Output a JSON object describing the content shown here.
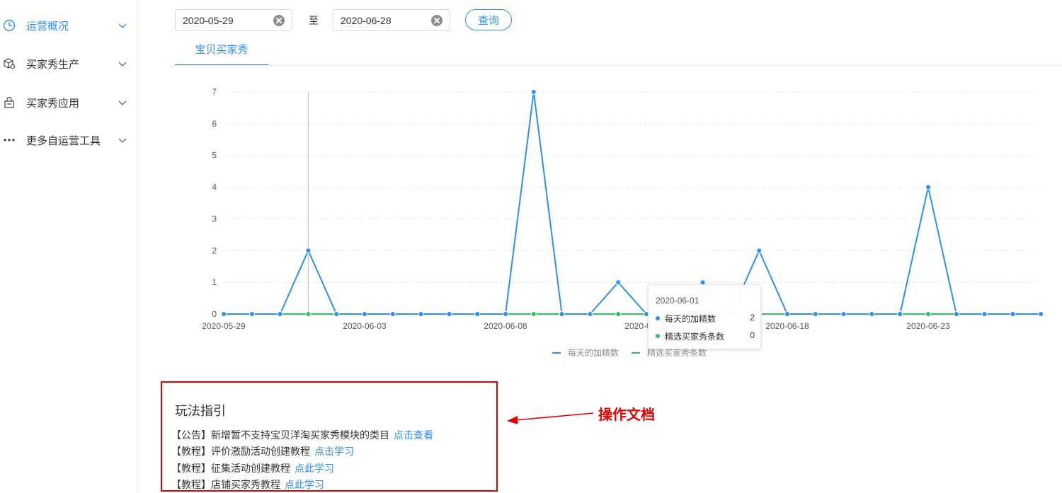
{
  "sidebar": {
    "items": [
      {
        "label": "运营概况",
        "icon": "clock-icon",
        "active": true
      },
      {
        "label": "买家秀生产",
        "icon": "box-icon",
        "active": false
      },
      {
        "label": "买家秀应用",
        "icon": "bag-icon",
        "active": false
      },
      {
        "label": "更多自运营工具",
        "icon": "more-dots-icon",
        "active": false
      }
    ]
  },
  "filter": {
    "start_date": "2020-05-29",
    "to_label": "至",
    "end_date": "2020-06-28",
    "query_label": "查询"
  },
  "tab": {
    "label": "宝贝买家秀"
  },
  "chart_data": {
    "type": "line",
    "title": "",
    "xlabel": "",
    "ylabel": "",
    "ylim": [
      0,
      7
    ],
    "yticks": [
      0,
      1,
      2,
      3,
      4,
      5,
      6,
      7
    ],
    "xtick_labels": [
      "2020-05-29",
      "2020-06-03",
      "2020-06-08",
      "2020-06-13",
      "2020-06-18",
      "2020-06-23"
    ],
    "x": [
      "2020-05-29",
      "2020-05-30",
      "2020-05-31",
      "2020-06-01",
      "2020-06-02",
      "2020-06-03",
      "2020-06-04",
      "2020-06-05",
      "2020-06-06",
      "2020-06-07",
      "2020-06-08",
      "2020-06-09",
      "2020-06-10",
      "2020-06-11",
      "2020-06-12",
      "2020-06-13",
      "2020-06-14",
      "2020-06-15",
      "2020-06-16",
      "2020-06-17",
      "2020-06-18",
      "2020-06-19",
      "2020-06-20",
      "2020-06-21",
      "2020-06-22",
      "2020-06-23",
      "2020-06-24",
      "2020-06-25",
      "2020-06-26",
      "2020-06-27"
    ],
    "series": [
      {
        "name": "每天的加精数",
        "color": "#2a8ff7",
        "values": [
          0,
          0,
          0,
          2,
          0,
          0,
          0,
          0,
          0,
          0,
          0,
          7,
          0,
          0,
          1,
          0,
          0,
          1,
          0,
          2,
          0,
          0,
          0,
          0,
          0,
          4,
          0,
          0,
          0,
          0
        ]
      },
      {
        "name": "精选买家秀条数",
        "color": "#2fc25b",
        "values": [
          0,
          0,
          0,
          0,
          0,
          0,
          0,
          0,
          0,
          0,
          0,
          0,
          0,
          0,
          0,
          0,
          0,
          0,
          0,
          0,
          0,
          0,
          0,
          0,
          0,
          0,
          0,
          0,
          0,
          0
        ]
      }
    ],
    "grid": true,
    "legend_position": "bottom-center",
    "tooltip": {
      "date": "2020-06-01",
      "rows": [
        {
          "name": "每天的加精数",
          "value": "2"
        },
        {
          "name": "精选买家秀条数",
          "value": "0"
        }
      ]
    }
  },
  "guide": {
    "title": "玩法指引",
    "items": [
      {
        "text": "【公告】新增暂不支持宝贝洋淘买家秀模块的类目",
        "link": "点击查看"
      },
      {
        "text": "【教程】评价激励活动创建教程",
        "link": "点击学习"
      },
      {
        "text": "【教程】征集活动创建教程",
        "link": "点此学习"
      },
      {
        "text": "【教程】店铺买家秀教程",
        "link": "点此学习"
      }
    ]
  },
  "annotation": {
    "label": "操作文档"
  }
}
